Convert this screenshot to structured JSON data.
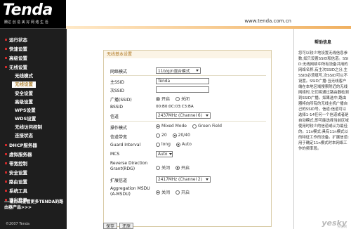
{
  "header": {
    "logo": "Tenda",
    "slogan": "腾达 创 造 美 好 网 络 生 活",
    "url": "www.tenda.com.cn"
  },
  "sidebar": {
    "items": [
      {
        "label": "运行状态",
        "level": 0
      },
      {
        "label": "快速设置",
        "level": 0
      },
      {
        "label": "高级设置",
        "level": 0
      },
      {
        "label": "无线设置",
        "level": 0
      },
      {
        "label": "无线模式",
        "level": 1
      },
      {
        "label": "无线设置",
        "level": 1,
        "active": true
      },
      {
        "label": "安全设置",
        "level": 1
      },
      {
        "label": "高级设置",
        "level": 1
      },
      {
        "label": "WPS设置",
        "level": 1
      },
      {
        "label": "WDS设置",
        "level": 1
      },
      {
        "label": "无线访问控制",
        "level": 1
      },
      {
        "label": "连接状态",
        "level": 1
      },
      {
        "label": "DHCP服务器",
        "level": 0
      },
      {
        "label": "虚拟服务器",
        "level": 0
      },
      {
        "label": "带宽控制",
        "level": 0
      },
      {
        "label": "安全设置",
        "level": 0
      },
      {
        "label": "路由设置",
        "level": 0
      },
      {
        "label": "系统工具",
        "level": 0
      },
      {
        "label": "退出登录",
        "level": 0
      }
    ],
    "note": "---请点击查看更多TENDA的路由器产品>>>",
    "copyright": "©2007 Tenda"
  },
  "form": {
    "title": "无线基本设置",
    "fields": {
      "network_mode": {
        "label": "网络模式",
        "value": "11b/g/n混合模式"
      },
      "ssid": {
        "label": "主SSID",
        "value": "Tenda"
      },
      "ssid2": {
        "label": "次SSID",
        "value": ""
      },
      "broadcast": {
        "label": "广播(SSID)",
        "options": [
          "开启",
          "关闭"
        ],
        "selected": "开启"
      },
      "bssid": {
        "label": "BSSID",
        "value": "00:B0:0C:03:C3:BA"
      },
      "channel": {
        "label": "信道",
        "value": "2437MHz (Channel 6)"
      },
      "op_mode": {
        "label": "操作模式",
        "options": [
          "Mixed Mode",
          "Green Field"
        ],
        "selected": "Mixed Mode"
      },
      "bandwidth": {
        "label": "信道带宽",
        "options": [
          "20",
          "20/40"
        ],
        "selected": "20/40"
      },
      "guard": {
        "label": "Guard Interval",
        "options": [
          "long",
          "Auto"
        ],
        "selected": "Auto"
      },
      "mcs": {
        "label": "MCS",
        "value": "Auto"
      },
      "rdg_label_1": "Reverse Direction",
      "rdg_label_2": "Grant(RDG)",
      "rdg": {
        "options": [
          "关闭",
          "开启"
        ],
        "selected": "开启"
      },
      "ext_channel": {
        "label": "扩展信道",
        "value": "2417MHz (Channel 2)"
      },
      "amsdu_label_1": "Aggregation MSDU",
      "amsdu_label_2": "(A-MSDU)",
      "amsdu": {
        "options": [
          "关闭",
          "开启"
        ],
        "selected": "关闭"
      }
    },
    "buttons": {
      "save": "保存",
      "restore": "还原"
    }
  },
  "help": {
    "title": "帮助信息",
    "body": "您可以较少地设置无线信息参数,如只设置SSID和信道。SSID:无线网络中所有设备共用的网络名称,有主次SSID之分,主SSID必须填写,次SSID可以不设置。SSID广播:当无线客户端在本地区域搜索附近的无线网络时,它们将通过路由器检测到SSID广播。如果选中,路由器将向所有的无线主机广播自己的SSID号。信道:信道可以选择1-14任何一个信道或者是自动模式,即可能选择当前区域使用时较少的信道或认为最佳的。11n模式:具有11n模式以的特征工作的设备。扩展信道:用于确定11n模式时本网络工作的频率段。"
  },
  "watermark": {
    "text": "yesky",
    "sub": "天极网"
  }
}
